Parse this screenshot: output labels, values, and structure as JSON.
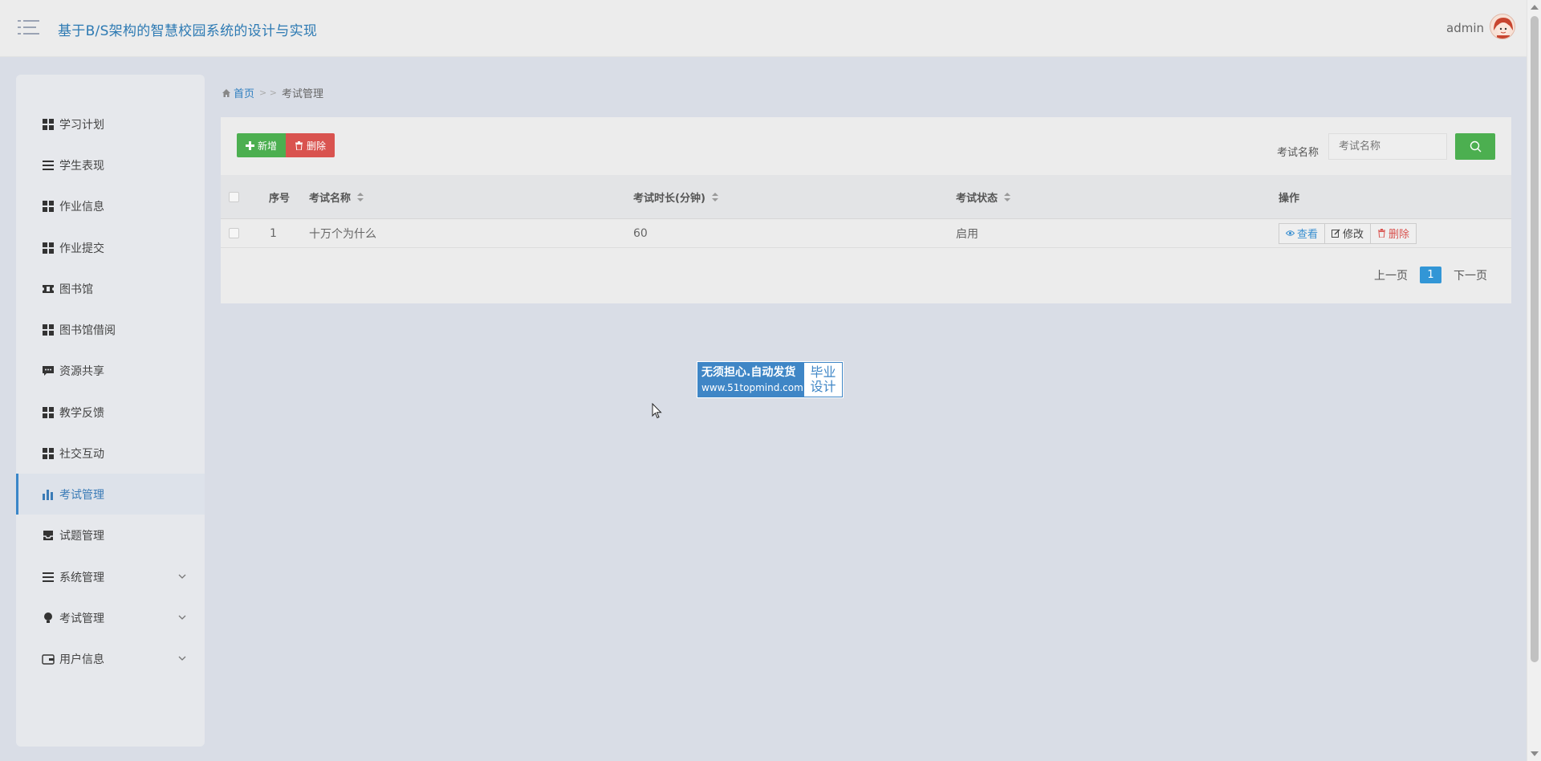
{
  "header": {
    "title": "基于B/S架构的智慧校园系统的设计与实现",
    "user": "admin"
  },
  "sidebar": {
    "items": [
      {
        "label": "学习计划",
        "icon": "grid-icon"
      },
      {
        "label": "学生表现",
        "icon": "list-icon"
      },
      {
        "label": "作业信息",
        "icon": "grid-icon"
      },
      {
        "label": "作业提交",
        "icon": "grid-icon"
      },
      {
        "label": "图书馆",
        "icon": "ticket-icon"
      },
      {
        "label": "图书馆借阅",
        "icon": "grid-icon"
      },
      {
        "label": "资源共享",
        "icon": "comment-icon"
      },
      {
        "label": "教学反馈",
        "icon": "grid-icon"
      },
      {
        "label": "社交互动",
        "icon": "grid-icon"
      },
      {
        "label": "考试管理",
        "icon": "bar-chart-icon",
        "active": true
      },
      {
        "label": "试题管理",
        "icon": "inbox-icon"
      },
      {
        "label": "系统管理",
        "icon": "list-icon",
        "expandable": true
      },
      {
        "label": "考试管理",
        "icon": "bulb-icon",
        "expandable": true
      },
      {
        "label": "用户信息",
        "icon": "wallet-icon",
        "expandable": true
      }
    ]
  },
  "breadcrumb": {
    "home": "首页",
    "separator": "> >",
    "current": "考试管理"
  },
  "toolbar": {
    "add_label": "新增",
    "delete_label": "删除"
  },
  "search": {
    "label": "考试名称",
    "placeholder": "考试名称"
  },
  "table": {
    "columns": [
      "序号",
      "考试名称",
      "考试时长(分钟)",
      "考试状态",
      "操作"
    ],
    "rows": [
      {
        "index": "1",
        "name": "十万个为什么",
        "duration": "60",
        "status": "启用"
      }
    ],
    "actions": {
      "view": "查看",
      "edit": "修改",
      "delete": "删除"
    }
  },
  "pagination": {
    "prev": "上一页",
    "current": "1",
    "next": "下一页"
  },
  "watermark": {
    "line1": "无须担心.自动发货",
    "line2": "www.51topmind.com",
    "side1": "毕业",
    "side2": "设计"
  },
  "colors": {
    "accent": "#2d7ab3",
    "success": "#4caf50",
    "danger": "#d9534f",
    "page_active": "#3296d6"
  }
}
